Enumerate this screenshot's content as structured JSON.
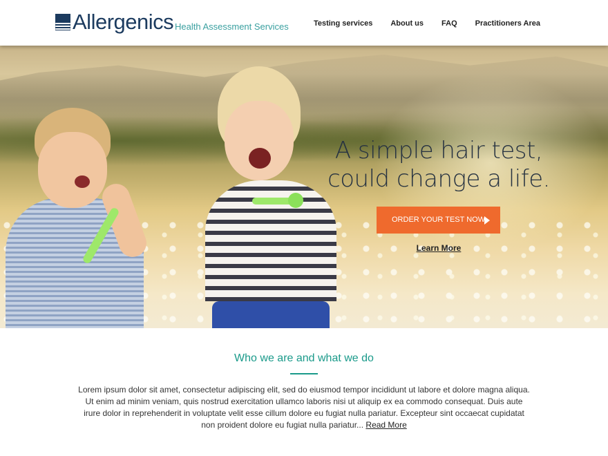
{
  "brand": {
    "name": "Allergenics",
    "tagline": "Health Assessment Services"
  },
  "nav": {
    "items": [
      {
        "label": "Testing services"
      },
      {
        "label": "About us"
      },
      {
        "label": "FAQ"
      },
      {
        "label": "Practitioners Area"
      }
    ]
  },
  "hero": {
    "headline_line1": "A simple hair test,",
    "headline_line2": "could change a life.",
    "cta_label": "ORDER YOUR TEST NOW",
    "learn_more_label": "Learn More"
  },
  "about": {
    "title": "Who we are and what we do",
    "body": "Lorem ipsum dolor sit amet, consectetur adipiscing elit, sed do eiusmod tempor incididunt ut labore et dolore magna aliqua. Ut enim ad minim veniam, quis nostrud exercitation ullamco laboris nisi ut aliquip ex ea commodo consequat. Duis aute irure dolor in reprehenderit in voluptate velit esse cillum dolore eu fugiat nulla pariatur. Excepteur sint occaecat cupidatat non proident dolore eu fugiat nulla pariatur...",
    "read_more_label": "Read More"
  },
  "colors": {
    "brand_navy": "#1c3b5f",
    "accent_teal": "#1a9a8a",
    "cta_orange": "#ef6a2d"
  },
  "icons": {
    "cta": "play-arrow-icon"
  }
}
